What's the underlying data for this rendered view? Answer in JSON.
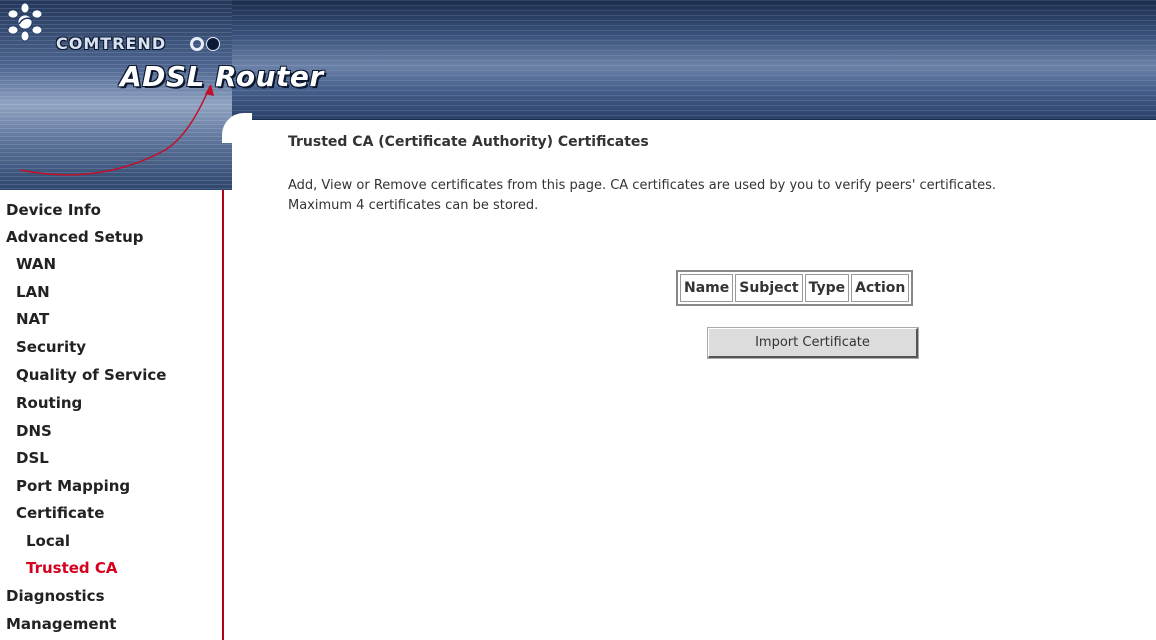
{
  "header": {
    "brand": "COMTREND",
    "product": "ADSL Router"
  },
  "sidebar": {
    "items": [
      {
        "label": "Device Info",
        "level": 0
      },
      {
        "label": "Advanced Setup",
        "level": 0
      },
      {
        "label": "WAN",
        "level": 1
      },
      {
        "label": "LAN",
        "level": 1
      },
      {
        "label": "NAT",
        "level": 1
      },
      {
        "label": "Security",
        "level": 1
      },
      {
        "label": "Quality of Service",
        "level": 1
      },
      {
        "label": "Routing",
        "level": 1
      },
      {
        "label": "DNS",
        "level": 1
      },
      {
        "label": "DSL",
        "level": 1
      },
      {
        "label": "Port Mapping",
        "level": 1
      },
      {
        "label": "Certificate",
        "level": 1
      },
      {
        "label": "Local",
        "level": 2
      },
      {
        "label": "Trusted CA",
        "level": 2,
        "active": true
      },
      {
        "label": "Diagnostics",
        "level": 0
      },
      {
        "label": "Management",
        "level": 0
      }
    ],
    "active_color": "#d4001e"
  },
  "main": {
    "title": "Trusted CA (Certificate Authority) Certificates",
    "description_line1": "Add, View or Remove certificates from this page. CA certificates are used by you to verify peers' certificates.",
    "description_line2": "Maximum 4 certificates can be stored.",
    "table": {
      "headers": [
        "Name",
        "Subject",
        "Type",
        "Action"
      ]
    },
    "import_button": "Import Certificate"
  }
}
